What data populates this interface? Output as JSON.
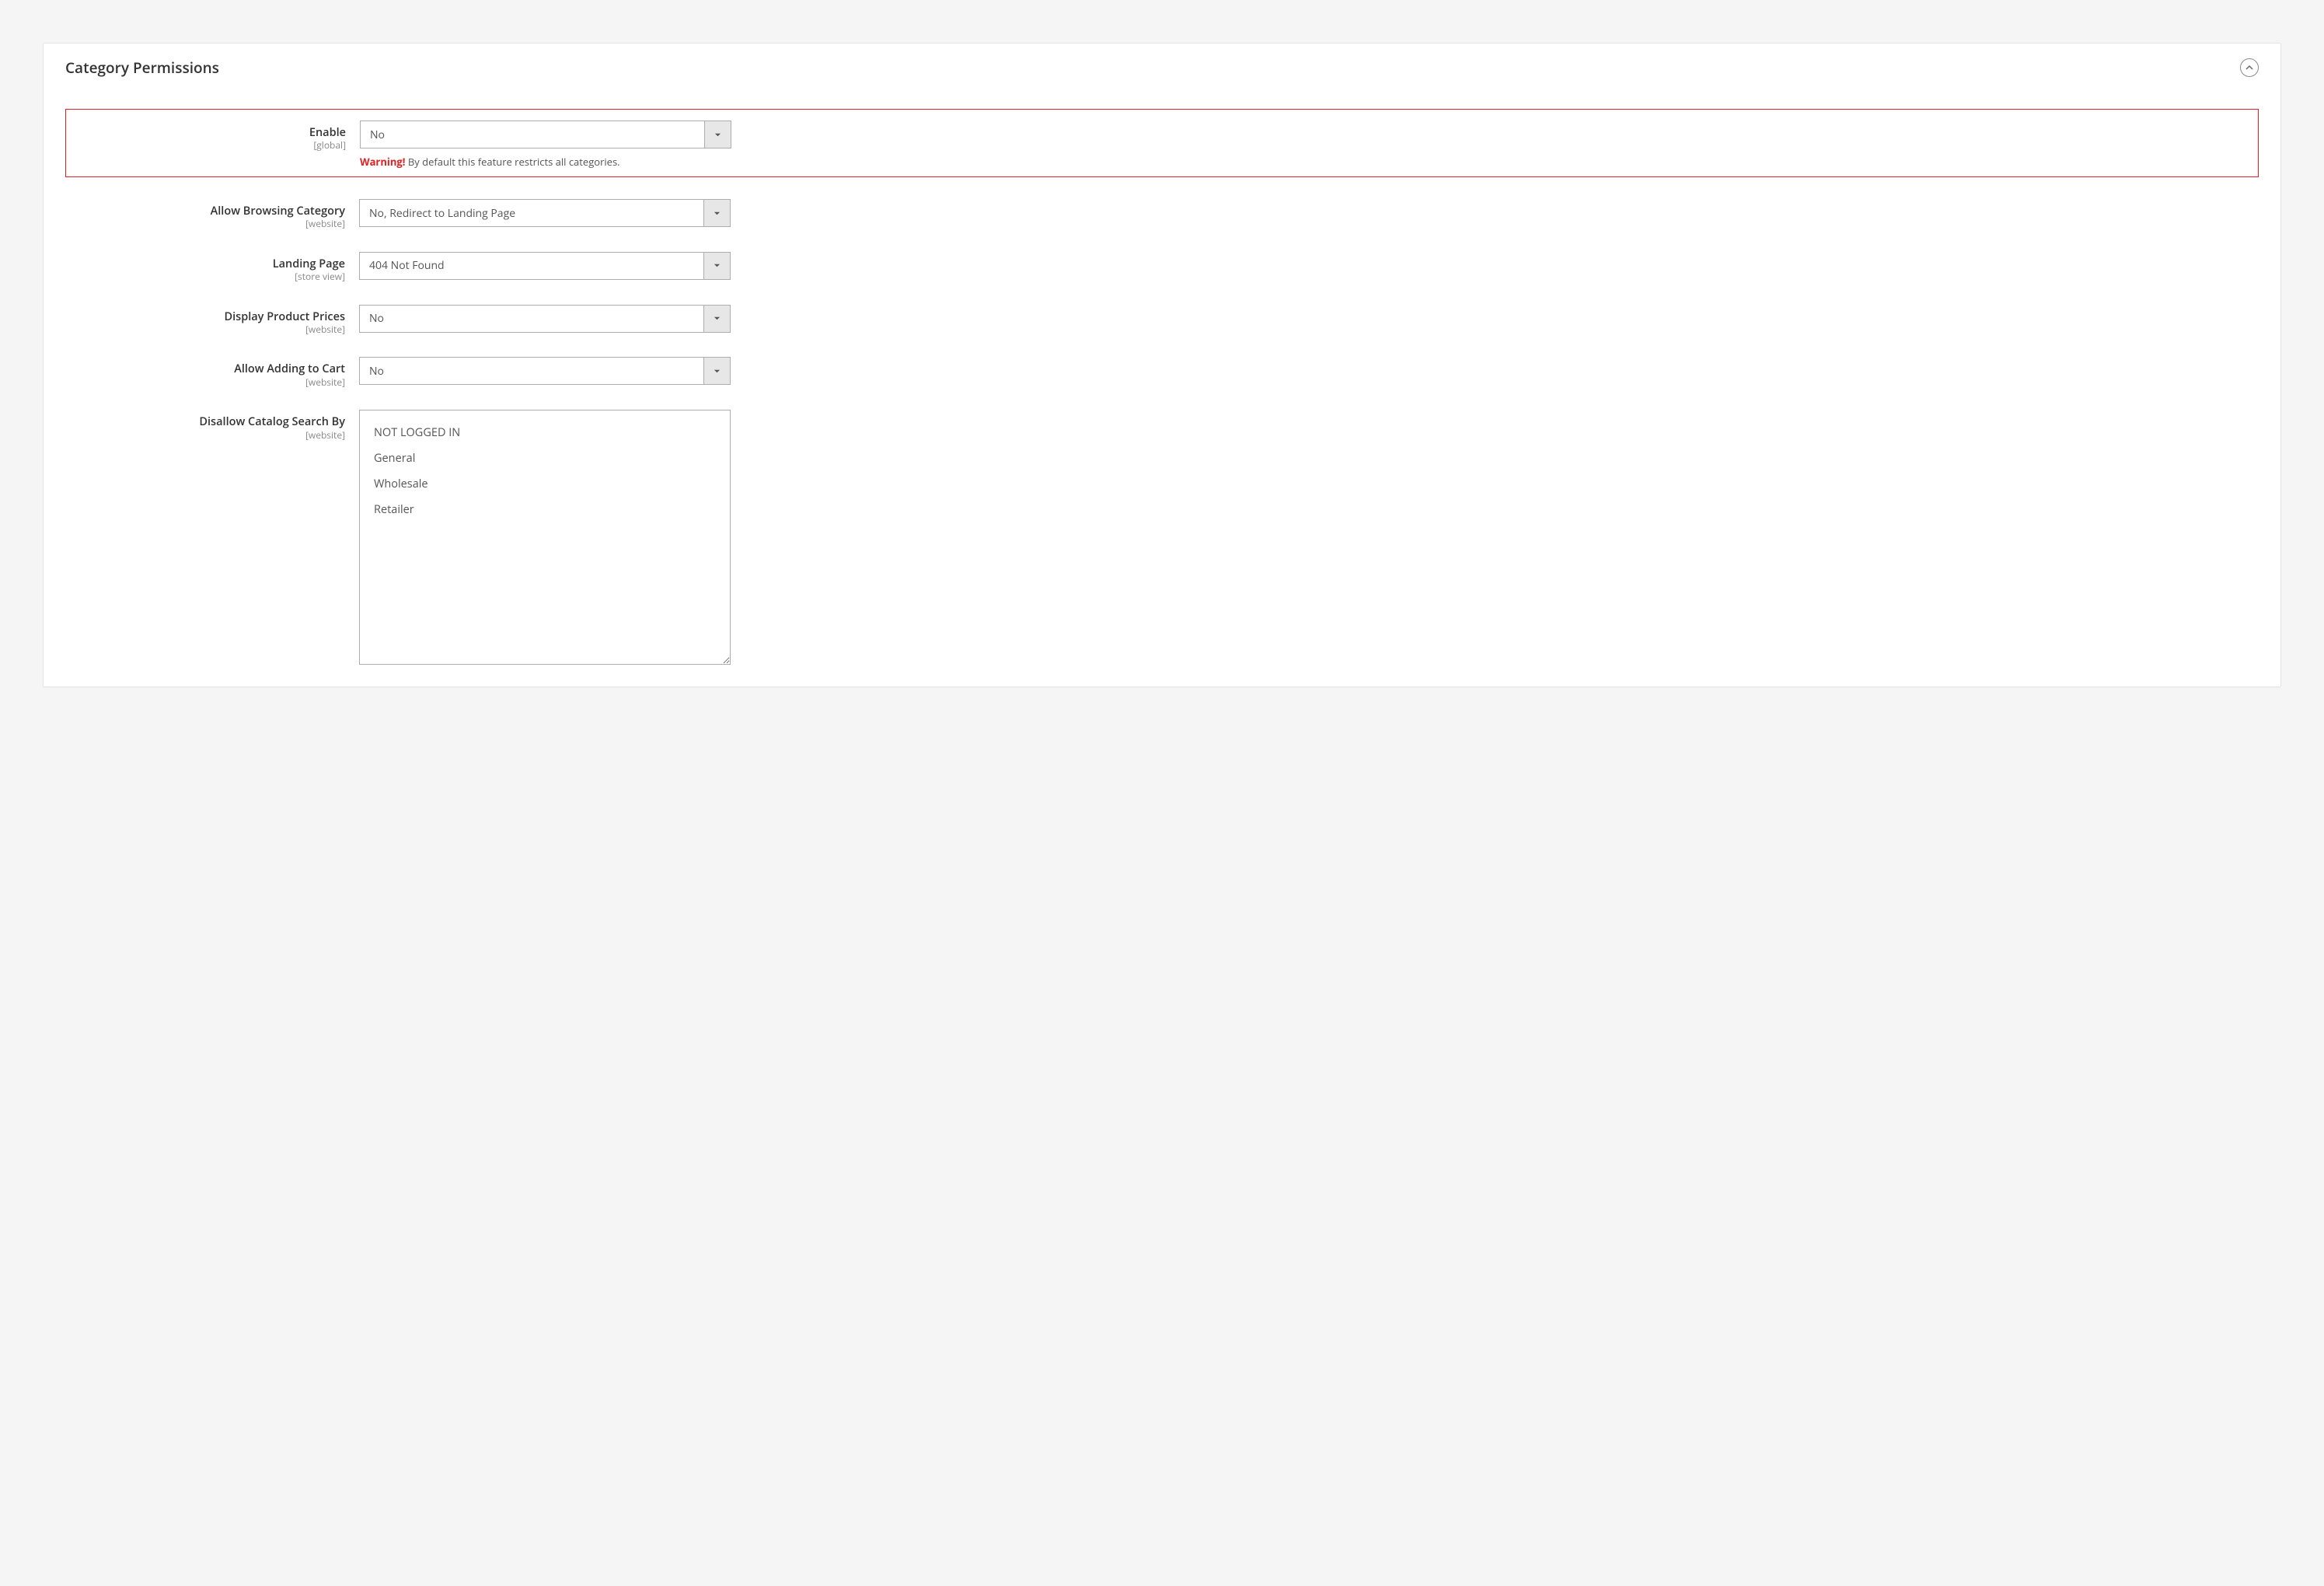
{
  "panel": {
    "title": "Category Permissions"
  },
  "fields": {
    "enable": {
      "label": "Enable",
      "scope": "[global]",
      "value": "No",
      "warning_label": "Warning!",
      "warning_text": " By default this feature restricts all categories."
    },
    "allow_browsing": {
      "label": "Allow Browsing Category",
      "scope": "[website]",
      "value": "No, Redirect to Landing Page"
    },
    "landing_page": {
      "label": "Landing Page",
      "scope": "[store view]",
      "value": "404 Not Found"
    },
    "display_prices": {
      "label": "Display Product Prices",
      "scope": "[website]",
      "value": "No"
    },
    "allow_add_cart": {
      "label": "Allow Adding to Cart",
      "scope": "[website]",
      "value": "No"
    },
    "disallow_search": {
      "label": "Disallow Catalog Search By",
      "scope": "[website]",
      "options": [
        "NOT LOGGED IN",
        "General",
        "Wholesale",
        "Retailer"
      ]
    }
  }
}
